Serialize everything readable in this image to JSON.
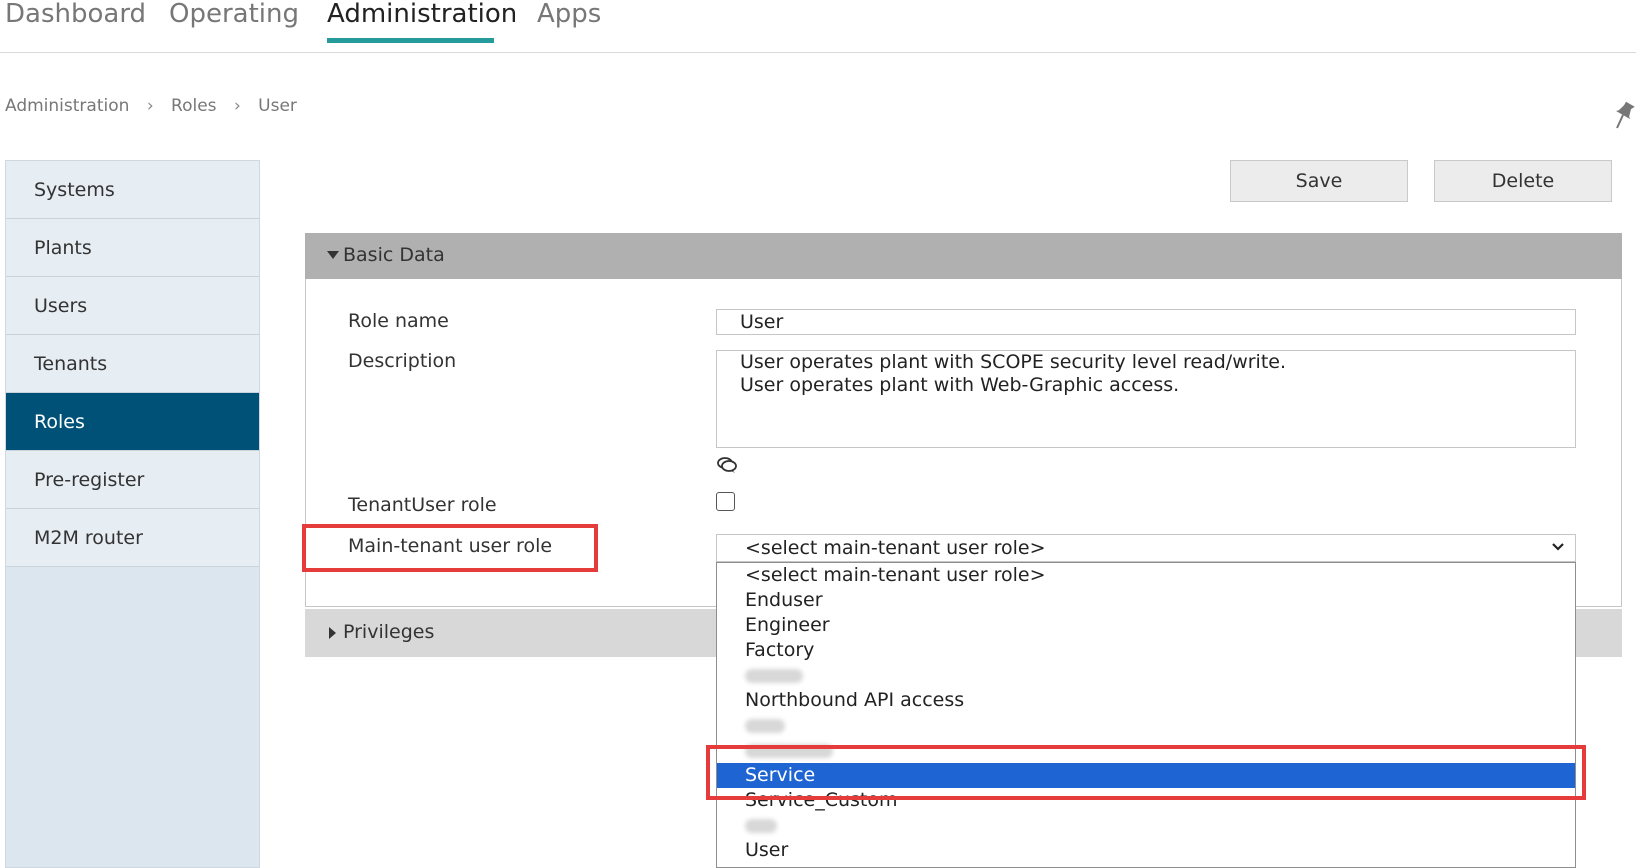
{
  "nav": {
    "tabs": [
      "Dashboard",
      "Operating",
      "Administration",
      "Apps"
    ],
    "active": "Administration"
  },
  "breadcrumb": [
    "Administration",
    "Roles",
    "User"
  ],
  "sidebar": {
    "items": [
      "Systems",
      "Plants",
      "Users",
      "Tenants",
      "Roles",
      "Pre-register",
      "M2M router"
    ],
    "active": "Roles"
  },
  "toolbar": {
    "save": "Save",
    "delete": "Delete"
  },
  "basic_data": {
    "title": "Basic Data",
    "role_name_label": "Role name",
    "role_name_value": "User",
    "description_label": "Description",
    "description_lines": [
      "User operates plant with SCOPE security level read/write.",
      "User operates plant with Web-Graphic access."
    ],
    "tenant_user_role_label": "TenantUser role",
    "tenant_user_role_checked": false,
    "main_tenant_label": "Main-tenant user role",
    "main_tenant_value": "<select main-tenant user role>"
  },
  "dropdown_options": [
    "<select main-tenant user role>",
    "Enduser",
    "Engineer",
    "Factory",
    "",
    "Northbound API access",
    "",
    "",
    "Service",
    "Service_Custom",
    "",
    "User"
  ],
  "dropdown_selected": "Service",
  "privileges": {
    "title": "Privileges"
  },
  "colors": {
    "accent_teal": "#259b9b",
    "sidebar_active": "#005177",
    "selection_blue": "#1e64d2",
    "highlight_red": "#e63b3b"
  }
}
